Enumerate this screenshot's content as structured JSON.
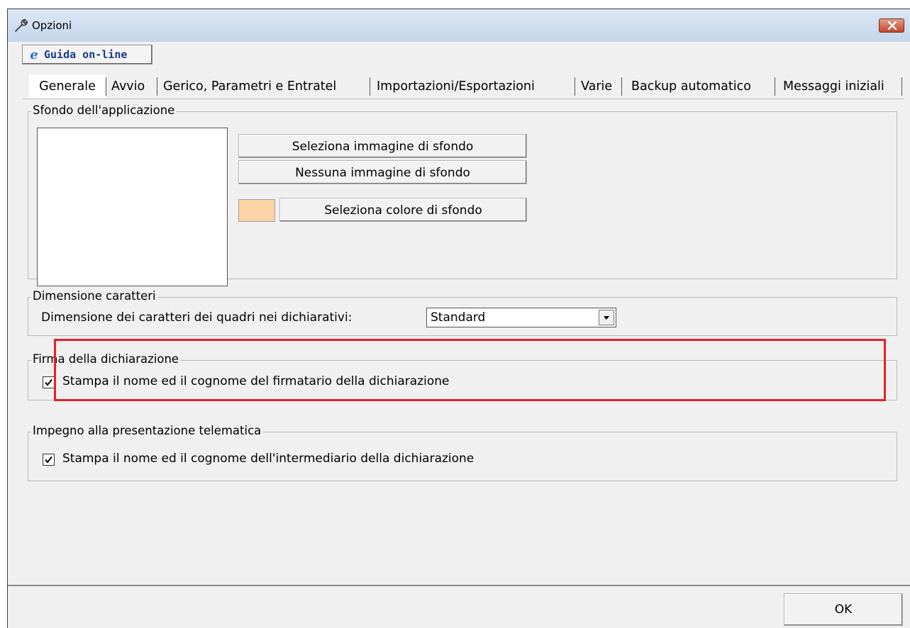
{
  "window": {
    "title": "Opzioni"
  },
  "help_button": {
    "label": "Guida on-line"
  },
  "tabs": [
    {
      "label": "Generale",
      "active": true
    },
    {
      "label": "Avvio"
    },
    {
      "label": "Gerico, Parametri e Entratel"
    },
    {
      "label": "Importazioni/Esportazioni"
    },
    {
      "label": "Varie"
    },
    {
      "label": "Backup automatico"
    },
    {
      "label": "Messaggi iniziali"
    }
  ],
  "background_group": {
    "title": "Sfondo dell'applicazione",
    "select_image_label": "Seleziona immagine di sfondo",
    "no_image_label": "Nessuna immagine di sfondo",
    "select_color_label": "Seleziona colore di sfondo",
    "swatch_color": "#fcd3a4"
  },
  "font_size_group": {
    "title": "Dimensione caratteri",
    "label": "Dimensione dei caratteri dei quadri nei dichiarativi:",
    "selected": "Standard"
  },
  "signature_group": {
    "title": "Firma della dichiarazione",
    "checkbox_label": "Stampa il nome ed il cognome del firmatario della dichiarazione",
    "checked": true
  },
  "telematic_group": {
    "title": "Impegno alla presentazione telematica",
    "checkbox_label": "Stampa il nome ed il cognome dell'intermediario della dichiarazione",
    "checked": true
  },
  "ok_button": {
    "label": "OK"
  },
  "colors": {
    "highlight": "#e5202a",
    "accent": "#1a3a8a"
  }
}
